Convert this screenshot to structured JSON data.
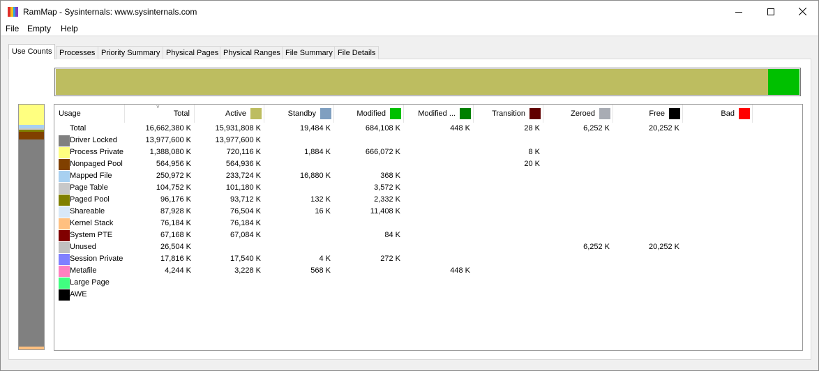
{
  "window": {
    "title": "RamMap - Sysinternals: www.sysinternals.com",
    "controls": [
      "minimize-icon",
      "maximize-icon",
      "close-icon"
    ]
  },
  "menu": [
    "File",
    "Empty",
    "Help"
  ],
  "tabs": [
    "Use Counts",
    "Processes",
    "Priority Summary",
    "Physical Pages",
    "Physical Ranges",
    "File Summary",
    "File Details"
  ],
  "active_tab": "Use Counts",
  "usage_bar": [
    {
      "name": "Active",
      "color": "#bdbd60",
      "fraction": 0.958
    },
    {
      "name": "Modified",
      "color": "#00c000",
      "fraction": 0.042
    }
  ],
  "left_bar": [
    {
      "name": "Process Private",
      "color": "#ffff80",
      "fraction": 0.083
    },
    {
      "name": "Mapped File",
      "color": "#a8d0f0",
      "fraction": 0.015
    },
    {
      "name": "Page Table",
      "color": "#c8c8c8",
      "fraction": 0.006
    },
    {
      "name": "Paged Pool",
      "color": "#808000",
      "fraction": 0.006
    },
    {
      "name": "Nonpaged Pool",
      "color": "#804000",
      "fraction": 0.034
    },
    {
      "name": "Driver Locked",
      "color": "#808080",
      "fraction": 0.846
    },
    {
      "name": "Kernel Stack",
      "color": "#ffc080",
      "fraction": 0.01
    }
  ],
  "table": {
    "columns": [
      {
        "label": "Usage",
        "color": null
      },
      {
        "label": "Total",
        "color": null
      },
      {
        "label": "Active",
        "color": "#bdbd60"
      },
      {
        "label": "Standby",
        "color": "#7f9fc0"
      },
      {
        "label": "Modified",
        "color": "#00c000"
      },
      {
        "label": "Modified ...",
        "color": "#008000"
      },
      {
        "label": "Transition",
        "color": "#600000"
      },
      {
        "label": "Zeroed",
        "color": "#a8acb4"
      },
      {
        "label": "Free",
        "color": "#000000"
      },
      {
        "label": "Bad",
        "color": "#ff0000"
      }
    ],
    "sorted_column": "Total",
    "rows": [
      {
        "label": "Total",
        "color": null,
        "values": [
          "16,662,380 K",
          "15,931,808 K",
          "19,484 K",
          "684,108 K",
          "448 K",
          "28 K",
          "6,252 K",
          "20,252 K",
          ""
        ]
      },
      {
        "label": "Driver Locked",
        "color": "#808080",
        "values": [
          "13,977,600 K",
          "13,977,600 K",
          "",
          "",
          "",
          "",
          "",
          "",
          ""
        ]
      },
      {
        "label": "Process Private",
        "color": "#ffff80",
        "values": [
          "1,388,080 K",
          "720,116 K",
          "1,884 K",
          "666,072 K",
          "",
          "8 K",
          "",
          "",
          ""
        ]
      },
      {
        "label": "Nonpaged Pool",
        "color": "#804000",
        "values": [
          "564,956 K",
          "564,936 K",
          "",
          "",
          "",
          "20 K",
          "",
          "",
          ""
        ]
      },
      {
        "label": "Mapped File",
        "color": "#a8d0f0",
        "values": [
          "250,972 K",
          "233,724 K",
          "16,880 K",
          "368 K",
          "",
          "",
          "",
          "",
          ""
        ]
      },
      {
        "label": "Page Table",
        "color": "#c8c8c8",
        "values": [
          "104,752 K",
          "101,180 K",
          "",
          "3,572 K",
          "",
          "",
          "",
          "",
          ""
        ]
      },
      {
        "label": "Paged Pool",
        "color": "#808000",
        "values": [
          "96,176 K",
          "93,712 K",
          "132 K",
          "2,332 K",
          "",
          "",
          "",
          "",
          ""
        ]
      },
      {
        "label": "Shareable",
        "color": "#d8e8f8",
        "values": [
          "87,928 K",
          "76,504 K",
          "16 K",
          "11,408 K",
          "",
          "",
          "",
          "",
          ""
        ]
      },
      {
        "label": "Kernel Stack",
        "color": "#ffc080",
        "values": [
          "76,184 K",
          "76,184 K",
          "",
          "",
          "",
          "",
          "",
          "",
          ""
        ]
      },
      {
        "label": "System PTE",
        "color": "#800000",
        "values": [
          "67,168 K",
          "67,084 K",
          "",
          "84 K",
          "",
          "",
          "",
          "",
          ""
        ]
      },
      {
        "label": "Unused",
        "color": "#c0c0c0",
        "values": [
          "26,504 K",
          "",
          "",
          "",
          "",
          "",
          "6,252 K",
          "20,252 K",
          ""
        ]
      },
      {
        "label": "Session Private",
        "color": "#8080ff",
        "values": [
          "17,816 K",
          "17,540 K",
          "4 K",
          "272 K",
          "",
          "",
          "",
          "",
          ""
        ]
      },
      {
        "label": "Metafile",
        "color": "#ff80c0",
        "values": [
          "4,244 K",
          "3,228 K",
          "568 K",
          "",
          "448 K",
          "",
          "",
          "",
          ""
        ]
      },
      {
        "label": "Large Page",
        "color": "#40ff80",
        "values": [
          "",
          "",
          "",
          "",
          "",
          "",
          "",
          "",
          ""
        ]
      },
      {
        "label": "AWE",
        "color": "#000000",
        "values": [
          "",
          "",
          "",
          "",
          "",
          "",
          "",
          "",
          ""
        ]
      }
    ]
  }
}
